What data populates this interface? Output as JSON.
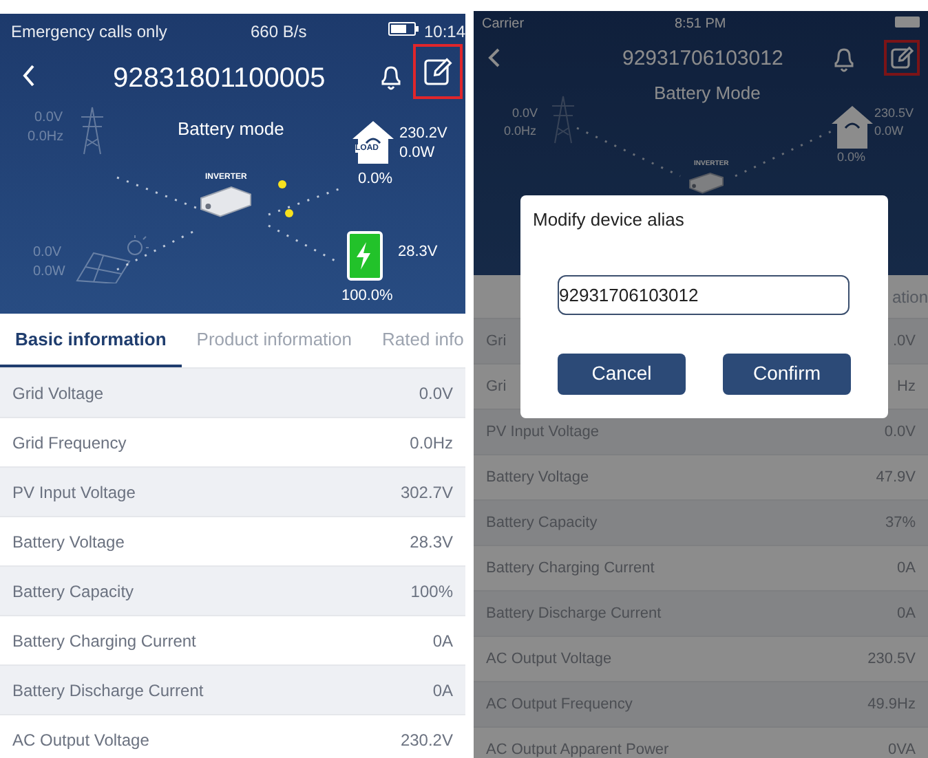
{
  "left_screen": {
    "status_bar": {
      "carrier": "Emergency calls only",
      "speed": "660 B/s",
      "time": "10:14"
    },
    "title": "92831801100005",
    "mode": "Battery mode",
    "grid": {
      "voltage": "0.0V",
      "frequency": "0.0Hz"
    },
    "load": {
      "label": "LOAD",
      "voltage": "230.2V",
      "power": "0.0W",
      "percent": "0.0%"
    },
    "inverter": "INVERTER",
    "battery": {
      "voltage": "28.3V",
      "percent": "100.0%",
      "level": 1.0
    },
    "pv": {
      "voltage": "0.0V",
      "power": "0.0W"
    },
    "tabs": [
      {
        "label": "Basic information",
        "selected": true
      },
      {
        "label": "Product information",
        "selected": false
      },
      {
        "label": "Rated info",
        "selected": false
      }
    ],
    "rows": [
      {
        "label": "Grid Voltage",
        "value": "0.0V"
      },
      {
        "label": "Grid Frequency",
        "value": "0.0Hz"
      },
      {
        "label": "PV Input Voltage",
        "value": "302.7V"
      },
      {
        "label": "Battery Voltage",
        "value": "28.3V"
      },
      {
        "label": "Battery Capacity",
        "value": "100%"
      },
      {
        "label": "Battery Charging Current",
        "value": "0A"
      },
      {
        "label": "Battery Discharge Current",
        "value": "0A"
      },
      {
        "label": "AC Output Voltage",
        "value": "230.2V"
      }
    ]
  },
  "right_screen": {
    "status_bar": {
      "carrier": "Carrier",
      "time": "8:51 PM"
    },
    "title": "92931706103012",
    "mode": "Battery Mode",
    "grid": {
      "voltage": "0.0V",
      "frequency": "0.0Hz"
    },
    "load": {
      "voltage": "230.5V",
      "power": "0.0W",
      "percent": "0.0%"
    },
    "inverter": "INVERTER",
    "tabs": [
      {
        "label": "ation",
        "selected": false
      }
    ],
    "rows": [
      {
        "label": "Gri",
        "value": ".0V"
      },
      {
        "label": "Gri",
        "value": "Hz"
      },
      {
        "label": "PV Input Voltage",
        "value": "0.0V"
      },
      {
        "label": "Battery Voltage",
        "value": "47.9V"
      },
      {
        "label": "Battery Capacity",
        "value": "37%"
      },
      {
        "label": "Battery Charging Current",
        "value": "0A"
      },
      {
        "label": "Battery Discharge Current",
        "value": "0A"
      },
      {
        "label": "AC Output Voltage",
        "value": "230.5V"
      },
      {
        "label": "AC Output Frequency",
        "value": "49.9Hz"
      },
      {
        "label": "AC Output Apparent Power",
        "value": "0VA"
      }
    ],
    "dialog": {
      "title": "Modify device alias",
      "value": "92931706103012",
      "buttons": [
        "Cancel",
        "Confirm"
      ]
    }
  }
}
